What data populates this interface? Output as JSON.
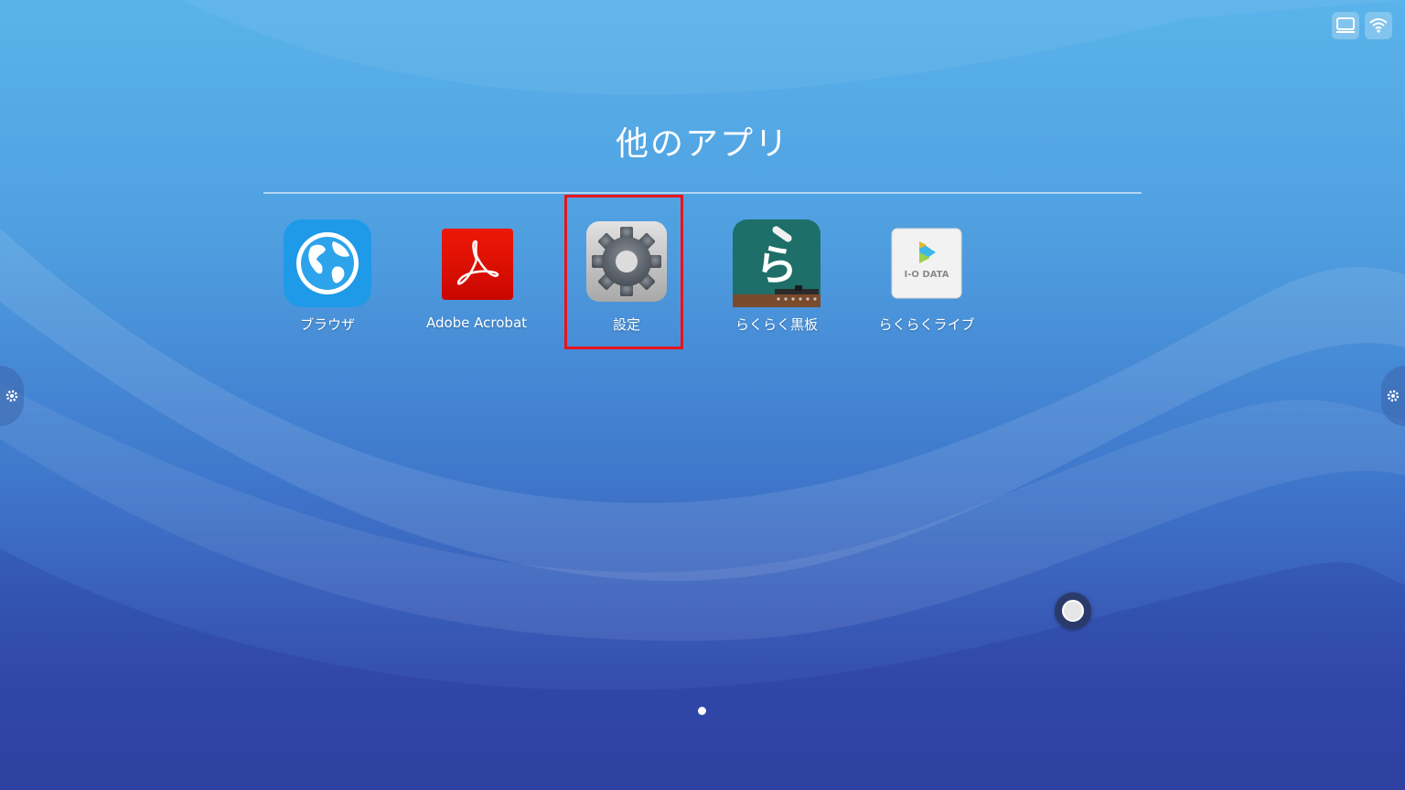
{
  "screen": {
    "title": "他のアプリ"
  },
  "apps": [
    {
      "label": "ブラウザ",
      "icon": "globe-icon"
    },
    {
      "label": "Adobe Acrobat",
      "icon": "acrobat-icon"
    },
    {
      "label": "設定",
      "icon": "gear-icon"
    },
    {
      "label": "らくらく黒板",
      "icon": "blackboard-icon",
      "glyph": "ら"
    },
    {
      "label": "らくらくライブ",
      "icon": "iodata-live-icon",
      "brand": "I-O DATA"
    }
  ],
  "status_bar": {
    "icons": [
      "display-icon",
      "wifi-icon"
    ]
  },
  "colors": {
    "highlight": "#e8141c",
    "acrobat_red": "#e00c00",
    "board_green": "#1e6f69"
  },
  "pager": {
    "pages": 1,
    "current": 1
  }
}
